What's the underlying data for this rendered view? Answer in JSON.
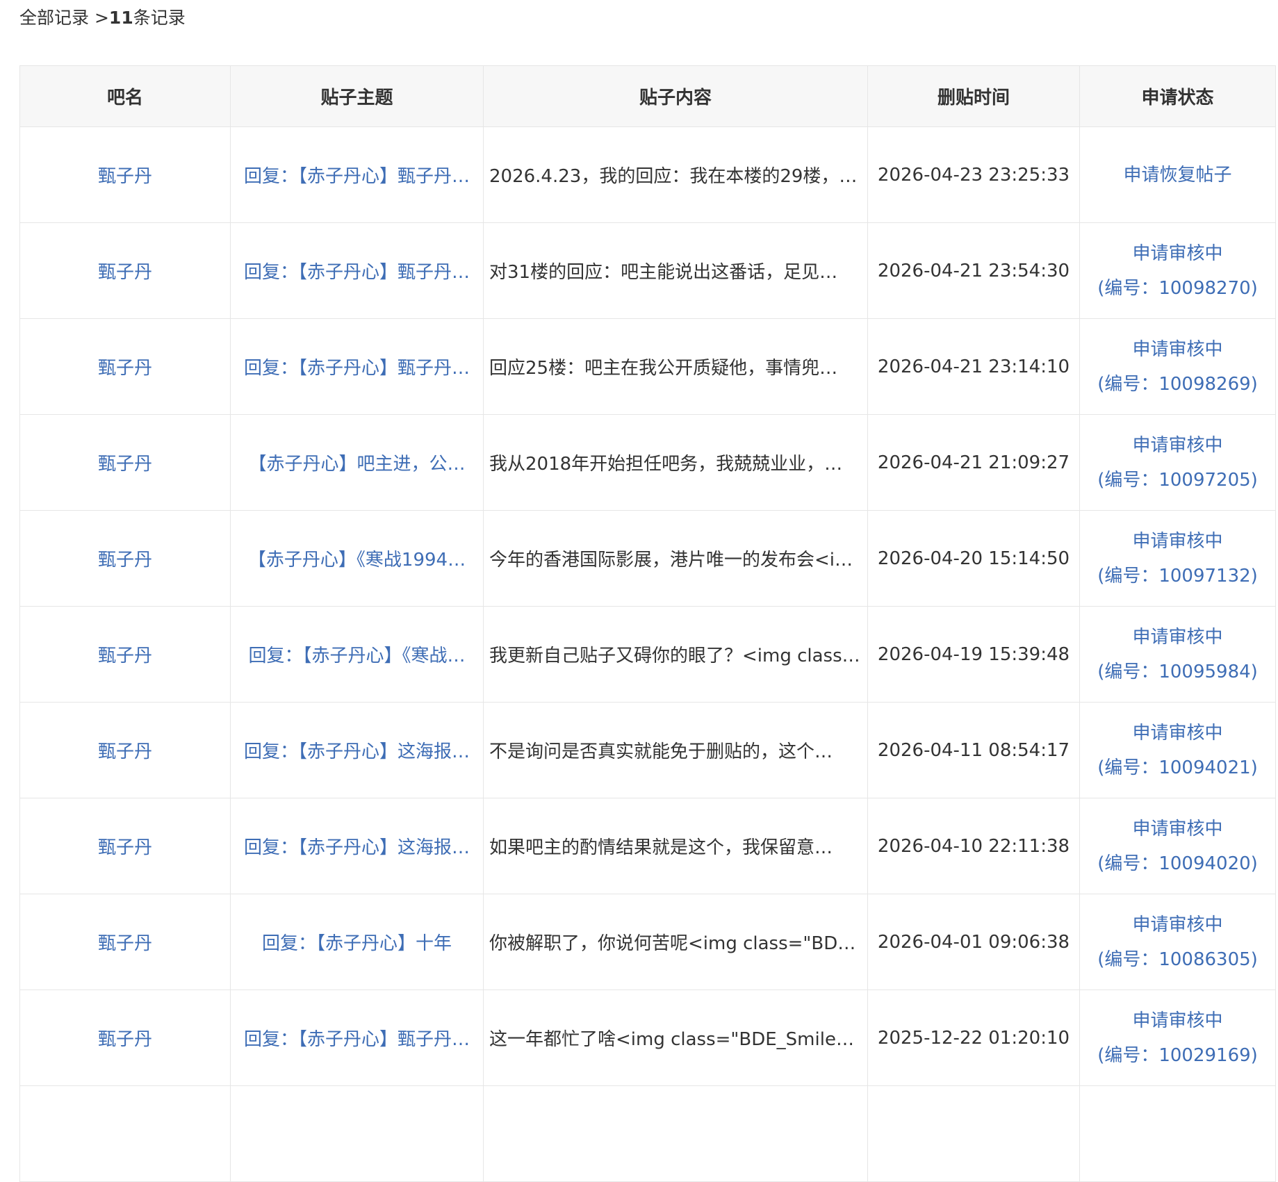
{
  "breadcrumb": {
    "all": "全部记录",
    "separator": " >",
    "count": "11",
    "suffix": "条记录"
  },
  "table": {
    "headers": {
      "name": "吧名",
      "title": "贴子主题",
      "content": "贴子内容",
      "time": "删贴时间",
      "status": "申请状态"
    },
    "rows": [
      {
        "name": "甄子丹",
        "title": "回复：【赤子丹心】甄子丹…",
        "content": "2026.4.23，我的回应：我在本楼的29楼，…",
        "time": "2026-04-23 23:25:33",
        "status_line1": "申请恢复帖子",
        "status_line2": ""
      },
      {
        "name": "甄子丹",
        "title": "回复：【赤子丹心】甄子丹…",
        "content": "对31楼的回应：吧主能说出这番话，足见…",
        "time": "2026-04-21 23:54:30",
        "status_line1": "申请审核中",
        "status_line2": "(编号：10098270)"
      },
      {
        "name": "甄子丹",
        "title": "回复：【赤子丹心】甄子丹…",
        "content": "回应25楼：吧主在我公开质疑他，事情兜…",
        "time": "2026-04-21 23:14:10",
        "status_line1": "申请审核中",
        "status_line2": "(编号：10098269)"
      },
      {
        "name": "甄子丹",
        "title": "【赤子丹心】吧主进，公…",
        "content": "我从2018年开始担任吧务，我兢兢业业，…",
        "time": "2026-04-21 21:09:27",
        "status_line1": "申请审核中",
        "status_line2": "(编号：10097205)"
      },
      {
        "name": "甄子丹",
        "title": "【赤子丹心】《寒战1994…",
        "content": "今年的香港国际影展，港片唯一的发布会<i…",
        "time": "2026-04-20 15:14:50",
        "status_line1": "申请审核中",
        "status_line2": "(编号：10097132)"
      },
      {
        "name": "甄子丹",
        "title": "回复：【赤子丹心】《寒战…",
        "content": "我更新自己贴子又碍你的眼了？<img class…",
        "time": "2026-04-19 15:39:48",
        "status_line1": "申请审核中",
        "status_line2": "(编号：10095984)"
      },
      {
        "name": "甄子丹",
        "title": "回复：【赤子丹心】这海报…",
        "content": "不是询问是否真实就能免于删贴的，这个…",
        "time": "2026-04-11 08:54:17",
        "status_line1": "申请审核中",
        "status_line2": "(编号：10094021)"
      },
      {
        "name": "甄子丹",
        "title": "回复：【赤子丹心】这海报…",
        "content": "如果吧主的酌情结果就是这个，我保留意…",
        "time": "2026-04-10 22:11:38",
        "status_line1": "申请审核中",
        "status_line2": "(编号：10094020)"
      },
      {
        "name": "甄子丹",
        "title": "回复：【赤子丹心】十年",
        "content": "你被解职了，你说何苦呢<img class=\"BDE…",
        "time": "2026-04-01 09:06:38",
        "status_line1": "申请审核中",
        "status_line2": "(编号：10086305)"
      },
      {
        "name": "甄子丹",
        "title": "回复：【赤子丹心】甄子丹…",
        "content": "这一年都忙了啥<img class=\"BDE_Smiley\"…",
        "time": "2025-12-22 01:20:10",
        "status_line1": "申请审核中",
        "status_line2": "(编号：10029169)"
      }
    ]
  }
}
